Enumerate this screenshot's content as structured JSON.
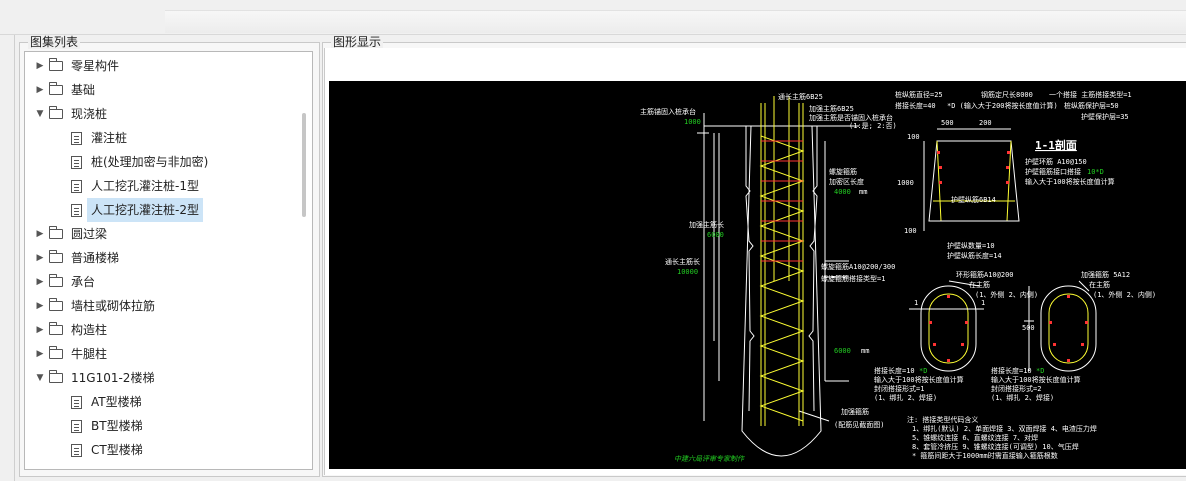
{
  "left_panel": {
    "title": "图集列表",
    "items": [
      {
        "label": "零星构件",
        "type": "folder",
        "state": "collapsed"
      },
      {
        "label": "基础",
        "type": "folder",
        "state": "collapsed"
      },
      {
        "label": "现浇桩",
        "type": "folder",
        "state": "expanded"
      },
      {
        "label": "灌注桩",
        "type": "doc"
      },
      {
        "label": "桩(处理加密与非加密)",
        "type": "doc"
      },
      {
        "label": "人工挖孔灌注桩-1型",
        "type": "doc"
      },
      {
        "label": "人工挖孔灌注桩-2型",
        "type": "doc",
        "selected": true
      },
      {
        "label": "圆过梁",
        "type": "folder",
        "state": "collapsed"
      },
      {
        "label": "普通楼梯",
        "type": "folder",
        "state": "collapsed"
      },
      {
        "label": "承台",
        "type": "folder",
        "state": "collapsed"
      },
      {
        "label": "墙柱或砌体拉筋",
        "type": "folder",
        "state": "collapsed"
      },
      {
        "label": "构造柱",
        "type": "folder",
        "state": "collapsed"
      },
      {
        "label": "牛腿柱",
        "type": "folder",
        "state": "collapsed"
      },
      {
        "label": "11G101-2楼梯",
        "type": "folder",
        "state": "expanded"
      },
      {
        "label": "AT型楼梯",
        "type": "doc"
      },
      {
        "label": "BT型楼梯",
        "type": "doc"
      },
      {
        "label": "CT型楼梯",
        "type": "doc"
      }
    ]
  },
  "right_panel": {
    "title": "图形显示"
  },
  "drawing": {
    "colors": {
      "background": "#000000",
      "line": "#ffffff",
      "value": "#22cc22",
      "rebar": "#ffff33",
      "tie": "#ff3333"
    },
    "texts": {
      "anchor_label": "主筋锚固入桩承台",
      "anchor_value": "1000",
      "through_bar": "通长主筋6B25",
      "add_bar": "加强主筋6B25",
      "add_anchor": "加强主筋是否锚固入桩承台",
      "add_anchor_opt": "(1:是; 2:否)",
      "spiral_label": "螺旋箍筋",
      "dense_len_label": "加密区长度",
      "dense_len_value": "4000",
      "unit_mm": "mm",
      "add_bar_len_label": "加强主筋长",
      "add_bar_len_value": "6000",
      "through_len_label": "通长主筋长",
      "through_len_value": "10000",
      "spiral_spec": "螺旋箍筋A10@200/300",
      "spiral_splice": "螺旋箍筋搭接类型=1",
      "nondense_label": "非加密区长度",
      "nondense_value": "6000",
      "bottom_label_1": "加强箍筋",
      "bottom_label_2": "(配筋见截面图)",
      "footer_credit": "中建六局评审专家制作",
      "top_right_1": "桩纵筋直径=25",
      "top_right_1b": "钢筋定尺长8000",
      "top_right_1c": "一个搭接  主筋搭接类型=1",
      "top_right_2": "搭接长度=40",
      "top_right_2b": "*D (输入大于200将按长度值计算)",
      "top_right_2c": "桩纵筋保护层=50",
      "top_right_3": "护壁保护层=35",
      "section_title": "1-1剖面",
      "dim_500a": "500",
      "dim_200": "200",
      "dim_100a": "100",
      "dim_1000": "1000",
      "dim_100b": "100",
      "wall_bar": "护壁环筋 A10@150",
      "wall_splice": "护壁箍筋接口搭接",
      "wall_splice_v": "10*D",
      "wall_note": "输入大于100将按长度值计算",
      "wall_long": "护壁纵筋6B14",
      "wall_count": "护壁纵数量=10",
      "wall_len": "护壁纵筋长度=14",
      "ring_title": "环形箍筋A10@200",
      "ring_main": "在主筋",
      "ring_opt": "(1、外侧 2、内侧)",
      "add_ring_title": "加强箍筋 5A12",
      "add_ring_main": "在主筋",
      "add_ring_opt": "(1、外侧 2、内侧)",
      "dim_500b": "500",
      "label_1a": "1",
      "label_1b": "1",
      "splice_a1": "搭接长度=10",
      "splice_a1b": "*D",
      "splice_a2": "输入大于100将按长度值计算",
      "splice_a3": "封闭搭接形式=1",
      "splice_a4": "(1、绑扎  2、焊接)",
      "splice_b1": "搭接长度=10",
      "splice_b1b": "*D",
      "splice_b2": "输入大于100将按长度值计算",
      "splice_b3": "封闭搭接形式=2",
      "splice_b4": "(1、绑扎  2、焊接)",
      "note_title": "注: 搭接类型代码含义",
      "note_1": "1、绑扎(默认)  2、单面焊接  3、双面焊接  4、电渣压力焊",
      "note_2": "5、锥螺纹连接  6、直螺纹连接  7、对焊",
      "note_3": "8、套管冷挤压  9、锥螺纹连接(可调型)  10、气压焊",
      "note_4": "* 箍筋间距大于1000mm时需直接输入箍筋根数"
    }
  }
}
